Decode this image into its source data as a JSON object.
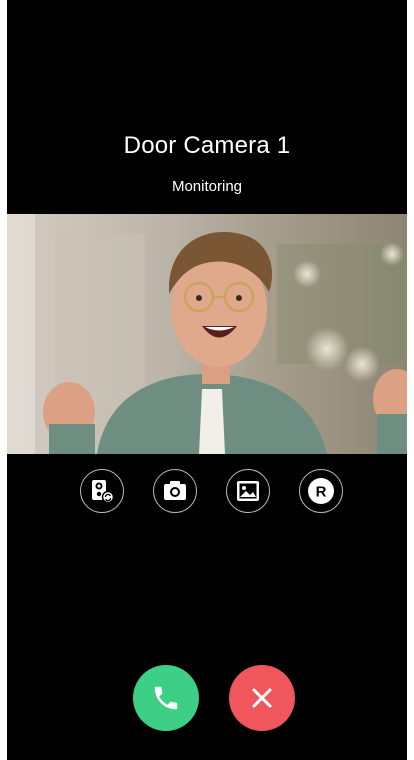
{
  "camera": {
    "title": "Door Camera 1",
    "status": "Monitoring"
  },
  "controls": [
    {
      "name": "switch-camera",
      "icon": "switch-camera-icon"
    },
    {
      "name": "snapshot",
      "icon": "camera-icon"
    },
    {
      "name": "gallery",
      "icon": "image-icon"
    },
    {
      "name": "record",
      "icon": "record-icon",
      "label": "R"
    }
  ],
  "call_actions": {
    "accept": {
      "icon": "phone-icon",
      "color": "#3ecf86"
    },
    "decline": {
      "icon": "close-icon",
      "color": "#f0575c"
    }
  },
  "colors": {
    "background": "#000000",
    "text": "#ffffff",
    "control_border": "#bdbdbd"
  }
}
